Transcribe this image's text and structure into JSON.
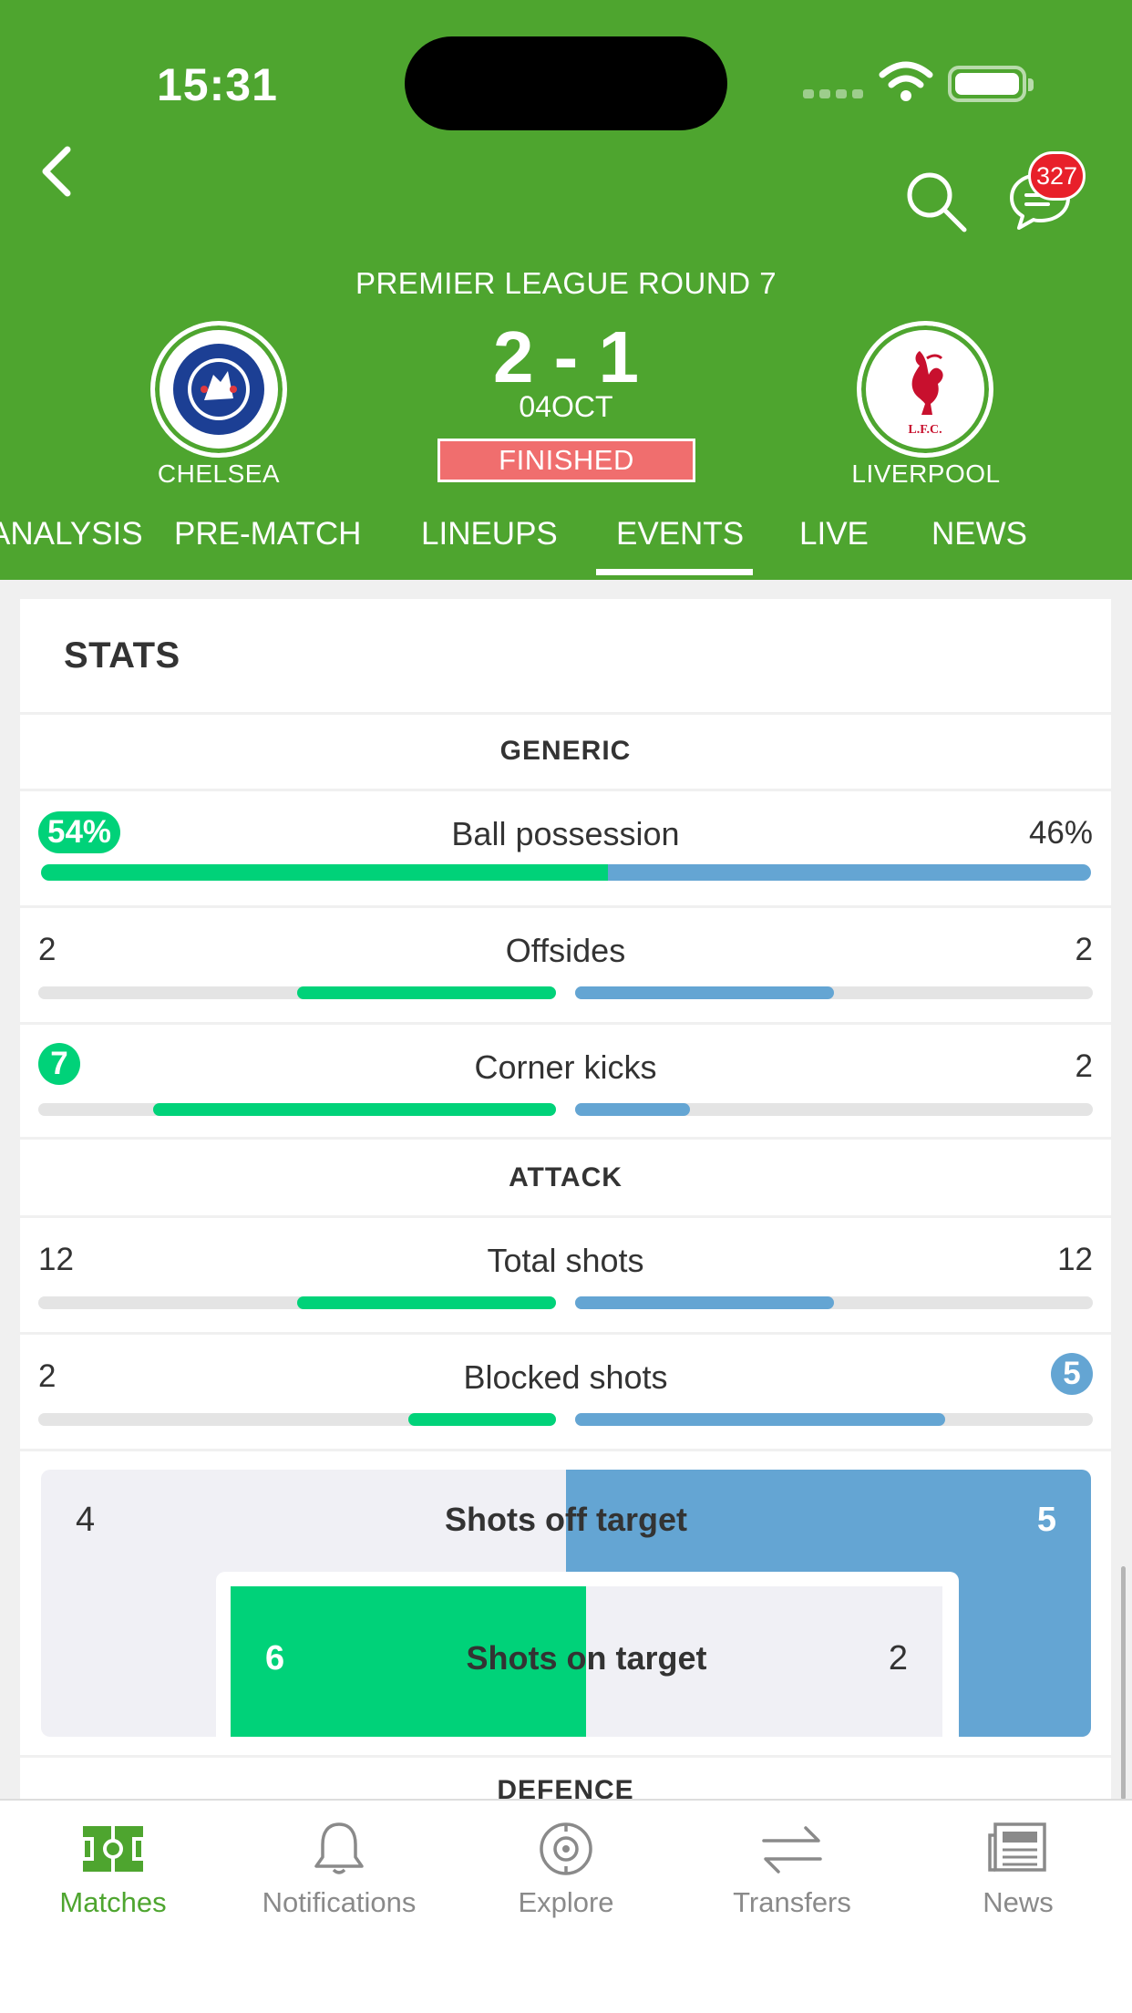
{
  "status_bar": {
    "time": "15:31"
  },
  "header": {
    "chat_badge": "327",
    "league": "PREMIER LEAGUE ROUND 7",
    "home_team": "CHELSEA",
    "away_team": "LIVERPOOL",
    "score": "2 - 1",
    "date": "04OCT",
    "status": "FINISHED",
    "home_crest_text": "CHELSEA FOOTBALL CLUB",
    "away_crest_text": "L.F.C."
  },
  "tabs": [
    {
      "label": "ANALYSIS"
    },
    {
      "label": "PRE-MATCH"
    },
    {
      "label": "LINEUPS"
    },
    {
      "label": "EVENTS",
      "active": true
    },
    {
      "label": "LIVE"
    },
    {
      "label": "NEWS"
    }
  ],
  "stats": {
    "title": "STATS",
    "sections": {
      "generic": "GENERIC",
      "attack": "ATTACK",
      "defence": "DEFENCE"
    },
    "rows": [
      {
        "label": "Ball possession",
        "home": "54%",
        "away": "46%",
        "home_value": 54,
        "away_value": 46,
        "highlight": "home"
      },
      {
        "label": "Offsides",
        "home": "2",
        "away": "2",
        "home_value": 2,
        "away_value": 2,
        "highlight": "none"
      },
      {
        "label": "Corner kicks",
        "home": "7",
        "away": "2",
        "home_value": 7,
        "away_value": 2,
        "highlight": "home"
      },
      {
        "label": "Total shots",
        "home": "12",
        "away": "12",
        "home_value": 12,
        "away_value": 12,
        "highlight": "none"
      },
      {
        "label": "Blocked shots",
        "home": "2",
        "away": "5",
        "home_value": 2,
        "away_value": 5,
        "highlight": "away"
      }
    ],
    "shots_off_target": {
      "label": "Shots off target",
      "home": "4",
      "away": "5"
    },
    "shots_on_target": {
      "label": "Shots on target",
      "home": "6",
      "away": "2"
    }
  },
  "bottom_nav": [
    {
      "label": "Matches",
      "icon": "pitch-icon",
      "active": true
    },
    {
      "label": "Notifications",
      "icon": "bell-icon"
    },
    {
      "label": "Explore",
      "icon": "compass-icon"
    },
    {
      "label": "Transfers",
      "icon": "transfer-arrows-icon"
    },
    {
      "label": "News",
      "icon": "newspaper-icon"
    }
  ],
  "colors": {
    "header_green": "#4ea52f",
    "home_green": "#00d279",
    "away_blue": "#64a5d3",
    "finished_red": "#f06e6e",
    "badge_red": "#e8202a"
  }
}
